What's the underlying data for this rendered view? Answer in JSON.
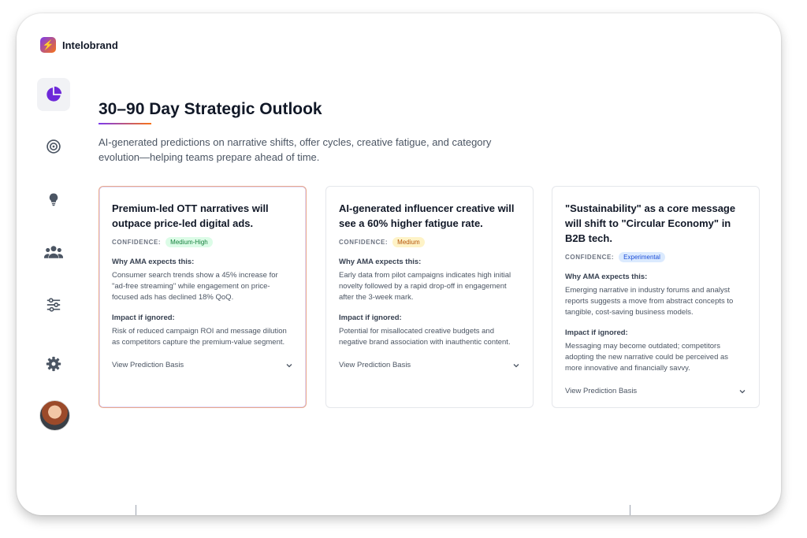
{
  "brand": {
    "name": "Intelobrand",
    "logo_icon": "lightning-icon"
  },
  "nav": {
    "items": [
      {
        "name": "analytics",
        "icon": "pie-chart-icon",
        "active": true
      },
      {
        "name": "targets",
        "icon": "target-icon",
        "active": false
      },
      {
        "name": "insights",
        "icon": "lightbulb-icon",
        "active": false
      },
      {
        "name": "audience",
        "icon": "users-icon",
        "active": false
      },
      {
        "name": "filters",
        "icon": "sliders-icon",
        "active": false
      },
      {
        "name": "settings",
        "icon": "gear-icon",
        "active": false
      }
    ],
    "avatar_icon": "user-avatar"
  },
  "page": {
    "title": "30–90 Day Strategic Outlook",
    "subtitle": "AI-generated predictions on narrative shifts, offer cycles, creative fatigue, and category evolution—helping teams prepare ahead of time."
  },
  "cards": [
    {
      "title": "Premium-led OTT narratives will outpace price-led digital ads.",
      "confidence_label": "CONFIDENCE:",
      "confidence": "Medium-High",
      "confidence_color": "#15803d",
      "why_label": "Why AMA expects this:",
      "why": "Consumer search trends show a 45% increase for \"ad-free streaming\" while engagement on price-focused ads has declined 18% QoQ.",
      "impact_label": "Impact if ignored:",
      "impact": "Risk of reduced campaign ROI and message dilution as competitors capture the premium-value segment.",
      "basis_label": "View Prediction Basis"
    },
    {
      "title": "AI-generated influencer creative will see a 60% higher fatigue rate.",
      "confidence_label": "CONFIDENCE:",
      "confidence": "Medium",
      "confidence_color": "#b45309",
      "why_label": "Why AMA expects this:",
      "why": "Early data from pilot campaigns indicates high initial novelty followed by a rapid drop-off in engagement after the 3-week mark.",
      "impact_label": "Impact if ignored:",
      "impact": "Potential for misallocated creative budgets and negative brand association with inauthentic content.",
      "basis_label": "View Prediction Basis"
    },
    {
      "title": "\"Sustainability\" as a core message will shift to \"Circular Economy\" in B2B tech.",
      "confidence_label": "CONFIDENCE:",
      "confidence": "Experimental",
      "confidence_color": "#1d4ed8",
      "why_label": "Why AMA expects this:",
      "why": "Emerging narrative in industry forums and analyst reports suggests a move from abstract concepts to tangible, cost-saving business models.",
      "impact_label": "Impact if ignored:",
      "impact": "Messaging may become outdated; competitors adopting the new narrative could be perceived as more innovative and financially savvy.",
      "basis_label": "View Prediction Basis"
    }
  ]
}
